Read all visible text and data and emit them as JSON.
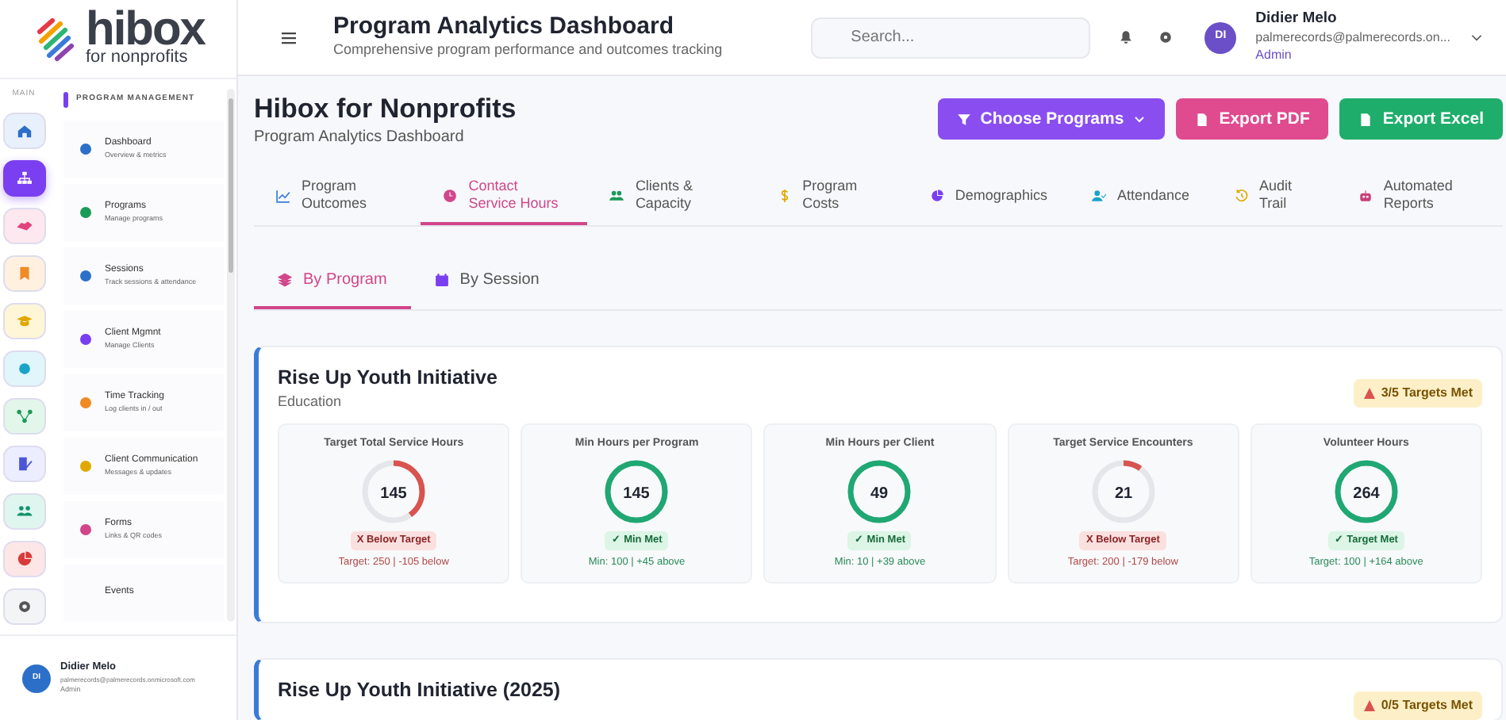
{
  "sidebar": {
    "logo": {
      "name": "hibox",
      "tagline": "for nonprofits"
    },
    "rail_label": "MAIN",
    "rail": [
      {
        "selected": false
      },
      {
        "selected": true
      },
      {
        "selected": false
      },
      {
        "selected": false
      },
      {
        "selected": false
      },
      {
        "selected": false
      },
      {
        "selected": false
      },
      {
        "selected": false
      },
      {
        "selected": false
      },
      {
        "selected": false
      },
      {
        "selected": false
      }
    ],
    "section": "PROGRAM MANAGEMENT",
    "items": [
      {
        "title": "Dashboard",
        "subtitle": "Overview & metrics"
      },
      {
        "title": "Programs",
        "subtitle": "Manage programs"
      },
      {
        "title": "Sessions",
        "subtitle": "Track sessions & attendance"
      },
      {
        "title": "Client Mgmnt",
        "subtitle": "Manage Clients"
      },
      {
        "title": "Time Tracking",
        "subtitle": "Log clients in / out"
      },
      {
        "title": "Client Communication",
        "subtitle": "Messages & updates"
      },
      {
        "title": "Forms",
        "subtitle": "Links & QR codes"
      },
      {
        "title": "Events"
      }
    ],
    "user": {
      "initials": "DI",
      "name": "Didier Melo",
      "email": "palmerecords@palmerecords.onmicrosoft.com",
      "role": "Admin"
    }
  },
  "header": {
    "title": "Program Analytics Dashboard",
    "subtitle": "Comprehensive program performance and outcomes tracking",
    "search": {
      "placeholder": "Search..."
    },
    "user": {
      "initials": "DI",
      "name": "Didier Melo",
      "email": "palmerecords@palmerecords.on...",
      "role": "Admin"
    }
  },
  "page": {
    "title": "Hibox for Nonprofits",
    "subtitle": "Program Analytics Dashboard",
    "buttons": [
      {
        "label": "Choose Programs",
        "kind": "filter"
      },
      {
        "label": "Export PDF",
        "kind": "pdf"
      },
      {
        "label": "Export Excel",
        "kind": "excel"
      }
    ]
  },
  "tabs": [
    {
      "label": "Program Outcomes",
      "selected": false
    },
    {
      "label": "Contact Service Hours",
      "selected": true
    },
    {
      "label": "Clients & Capacity",
      "selected": false
    },
    {
      "label": "Program Costs",
      "selected": false
    },
    {
      "label": "Demographics",
      "selected": false
    },
    {
      "label": "Attendance",
      "selected": false
    },
    {
      "label": "Audit Trail",
      "selected": false
    },
    {
      "label": "Automated Reports",
      "selected": false
    }
  ],
  "subtabs": [
    {
      "label": "By Program",
      "selected": true
    },
    {
      "label": "By Session",
      "selected": false
    }
  ],
  "programs": [
    {
      "name": "Rise Up Youth Initiative",
      "category": "Education",
      "badge": "3/5 Targets Met",
      "metrics": [
        {
          "title": "Target Total Service Hours",
          "value": "145",
          "level": 0.4,
          "met": false,
          "status": "X Below Target",
          "detail": "Target: 250 | -105 below"
        },
        {
          "title": "Min Hours per Program",
          "value": "145",
          "level": 1,
          "met": true,
          "status": "✓ Min Met",
          "detail": "Min: 100 | +45 above"
        },
        {
          "title": "Min Hours per Client",
          "value": "49",
          "level": 1,
          "met": true,
          "status": "✓ Min Met",
          "detail": "Min: 10 | +39 above"
        },
        {
          "title": "Target Service Encounters",
          "value": "21",
          "level": 0.1,
          "met": false,
          "status": "X Below Target",
          "detail": "Target: 200 | -179 below"
        },
        {
          "title": "Volunteer Hours",
          "value": "264",
          "level": 1,
          "met": true,
          "status": "✓ Target Met",
          "detail": "Target: 100 | +164 above"
        }
      ]
    },
    {
      "name": "Rise Up Youth Initiative (2025)",
      "badge": "0/5 Targets Met"
    }
  ]
}
